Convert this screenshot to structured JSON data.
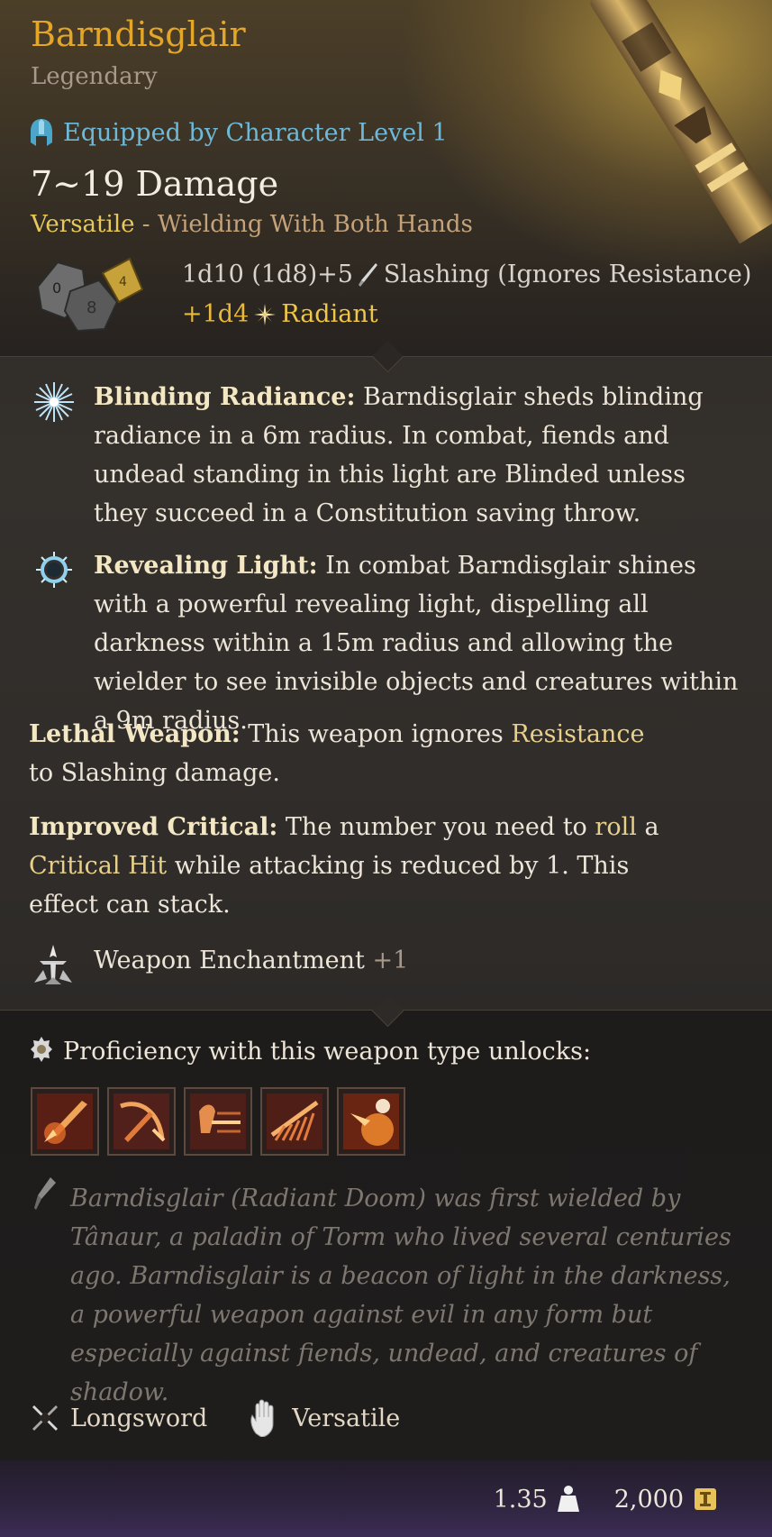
{
  "item": {
    "name": "Barndisglair",
    "rarity": "Legendary",
    "equip_requirement": "Equipped by Character Level 1",
    "damage_range": "7~19 Damage",
    "versatile_label": "Versatile",
    "versatile_mode": " - Wielding With Both Hands",
    "damage_line1_dice": "1d10 (1d8)+5",
    "damage_line1_type": "Slashing (Ignores Resistance)",
    "damage_line2_dice": "+1d4",
    "damage_line2_type": "Radiant"
  },
  "features": [
    {
      "name": "Blinding Radiance:",
      "text": "Barndisglair sheds blinding radiance in a 6m radius. In combat, fiends and undead standing in this light are Blinded unless they succeed in a Constitution saving throw.",
      "icon": "starburst-icon"
    },
    {
      "name": "Revealing Light:",
      "text": "In combat Barndisglair shines with a powerful revealing light, dispelling all darkness within a 15m radius and allowing the wielder to see invisible objects and creatures within a 9m radius.",
      "icon": "light-ring-icon"
    }
  ],
  "traits": {
    "lethal_name": "Lethal Weapon:",
    "lethal_text_a": "This weapon ignores",
    "lethal_kw": "Resistance",
    "lethal_text_b": "to Slashing damage.",
    "crit_name": "Improved Critical:",
    "crit_text_a": "The number you need to",
    "crit_kw1": "roll",
    "crit_text_b": "a",
    "crit_kw2": "Critical Hit",
    "crit_text_c": "while attacking is reduced by 1. This effect can stack."
  },
  "enchantment": {
    "label": "Weapon Enchantment",
    "value": "+1"
  },
  "proficiency": {
    "label": "Proficiency with this weapon type unlocks:",
    "skills": [
      "skill-icon-1",
      "skill-icon-2",
      "skill-icon-3",
      "skill-icon-4",
      "skill-icon-5"
    ]
  },
  "lore": "Barndisglair (Radiant Doom) was first wielded by Tânaur, a paladin of Torm who lived several centuries ago.  Barndisglair is a beacon of light in the darkness, a powerful weapon against evil in any form but especially against fiends, undead, and creatures of shadow.",
  "tags": {
    "type": "Longsword",
    "property": "Versatile"
  },
  "footer": {
    "weight": "1.35",
    "value": "2,000"
  },
  "colors": {
    "title": "#e3a629",
    "equip": "#6fb9d8",
    "radiant": "#f0c64a",
    "keyword": "#e9d08a"
  }
}
